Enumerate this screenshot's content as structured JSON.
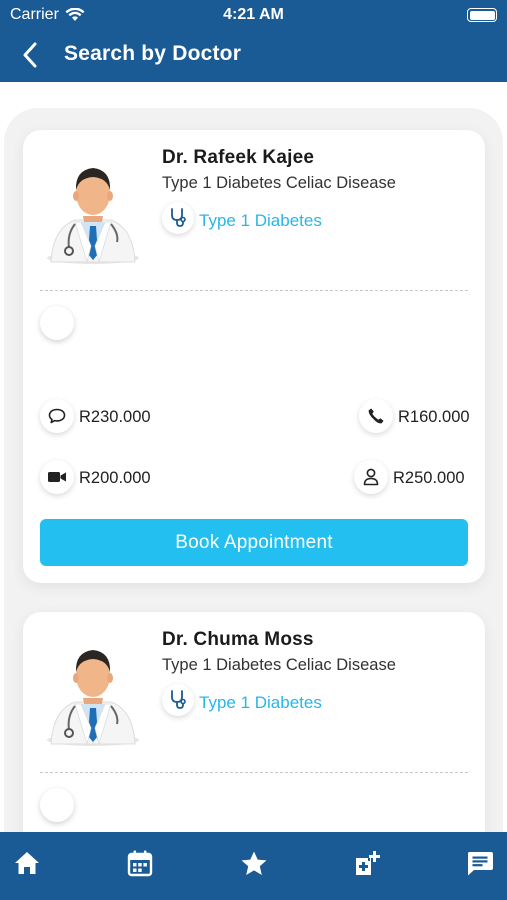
{
  "status_bar": {
    "carrier": "Carrier",
    "time": "4:21 AM"
  },
  "header": {
    "title": "Search by Doctor",
    "back_icon": "chevron-left-icon"
  },
  "doctors": [
    {
      "name": "Dr. Rafeek Kajee",
      "description": "Type 1 Diabetes Celiac Disease",
      "specialty": "Type 1 Diabetes",
      "prices": {
        "chat": "R230.000",
        "phone": "R160.000",
        "video": "R200.000",
        "in_person": "R250.000"
      },
      "book_label": "Book Appointment"
    },
    {
      "name": "Dr. Chuma Moss",
      "description": "Type 1 Diabetes Celiac Disease",
      "specialty": "Type 1 Diabetes"
    }
  ],
  "tabbar": [
    "home-icon",
    "calendar-icon",
    "star-icon",
    "medical-add-icon",
    "message-icon"
  ],
  "colors": {
    "primary": "#1a5a95",
    "accent": "#22bff0",
    "specialty_text": "#29b6e6"
  }
}
